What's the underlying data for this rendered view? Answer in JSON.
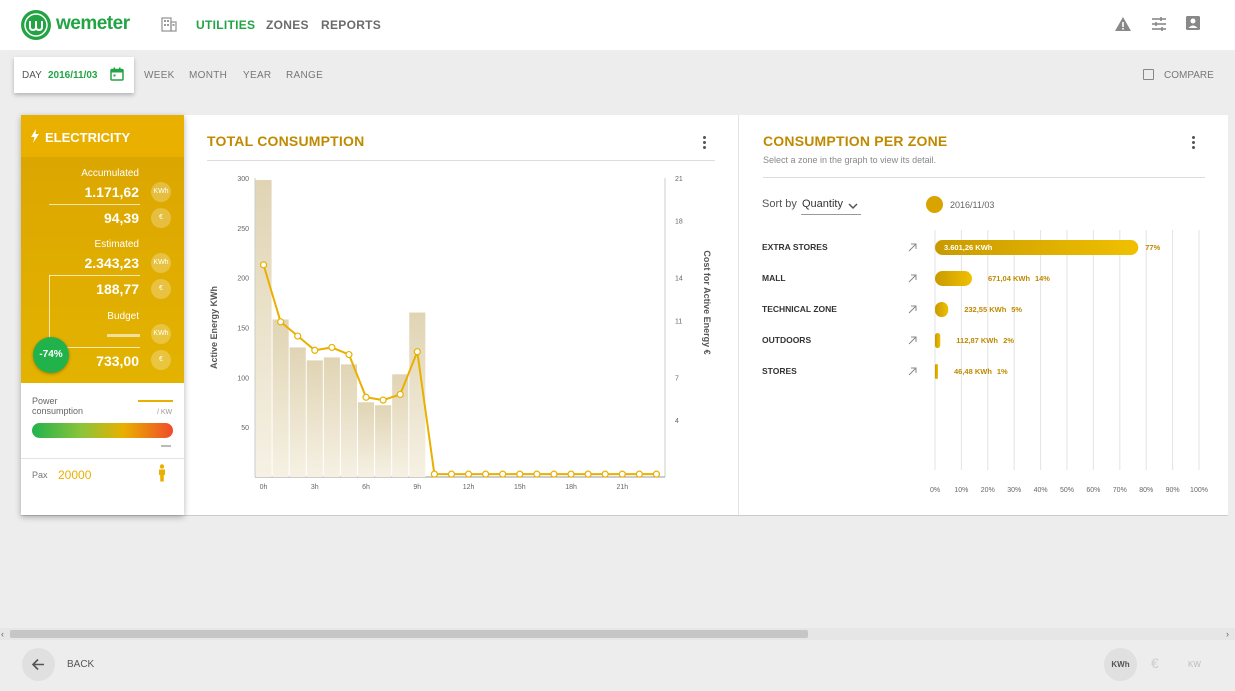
{
  "app": {
    "brand": "wemeter",
    "brand_color": "#22a445",
    "accent": "#e9b000"
  },
  "nav": {
    "items": [
      "UTILITIES",
      "ZONES",
      "REPORTS"
    ],
    "active": "UTILITIES"
  },
  "top_icons": [
    "warning-icon",
    "sliders-icon",
    "account-icon"
  ],
  "date": {
    "label": "DAY",
    "value": "2016/11/03",
    "periods": [
      "WEEK",
      "MONTH",
      "YEAR",
      "RANGE"
    ],
    "compare": "COMPARE"
  },
  "electricity": {
    "title": "ELECTRICITY",
    "accumulated_label": "Accumulated",
    "accumulated_kwh": "1.171,62",
    "accumulated_eur": "94,39",
    "estimated_label": "Estimated",
    "estimated_kwh": "2.343,23",
    "estimated_eur": "188,77",
    "budget_label": "Budget",
    "budget_eur": "733,00",
    "badge": "-74%",
    "unit_kwh": "KWh",
    "unit_eur": "€",
    "power_label_1": "Power",
    "power_label_2": "consumption",
    "power_unit": "/ KW",
    "pax_label": "Pax",
    "pax_value": "20000"
  },
  "total_consumption": {
    "title": "TOTAL CONSUMPTION"
  },
  "zone_panel": {
    "title": "CONSUMPTION PER ZONE",
    "subtitle": "Select a zone in the graph to view its detail.",
    "sort_label": "Sort by",
    "sort_value": "Quantity",
    "legend": "2016/11/03"
  },
  "chart_data": [
    {
      "type": "bar",
      "ylabel": "Active Energy KWh",
      "y2label": "Cost for Active Energy €",
      "yticks": [
        50,
        100,
        150,
        200,
        250,
        300
      ],
      "y2ticks": [
        4,
        7,
        11,
        14,
        18,
        21
      ],
      "ylim": [
        0,
        300
      ],
      "y2lim": [
        0,
        21
      ],
      "xticks": [
        "0h",
        "3h",
        "6h",
        "9h",
        "12h",
        "15h",
        "18h",
        "21h"
      ],
      "x": [
        0,
        1,
        2,
        3,
        4,
        5,
        6,
        7,
        8,
        9,
        10,
        11,
        12,
        13,
        14,
        15,
        16,
        17,
        18,
        19,
        20,
        21,
        22,
        23
      ],
      "series": [
        {
          "values": [
            298,
            158,
            130,
            117,
            120,
            113,
            75,
            72,
            103,
            165,
            0,
            0,
            0,
            0,
            0,
            0,
            0,
            0,
            0,
            0,
            0,
            0,
            0,
            0
          ]
        },
        {
          "values": [
            14.9,
            10.9,
            9.9,
            8.9,
            9.1,
            8.6,
            5.6,
            5.4,
            5.8,
            8.8,
            0.2,
            0.2,
            0.2,
            0.2,
            0.2,
            0.2,
            0.2,
            0.2,
            0.2,
            0.2,
            0.2,
            0.2,
            0.2,
            0.2
          ]
        }
      ]
    },
    {
      "type": "bar",
      "categories": [
        "EXTRA STORES",
        "MALL",
        "TECHNICAL ZONE",
        "OUTDOORS",
        "STORES"
      ],
      "value_labels": [
        "3.601,26 KWh",
        "671,04 KWh",
        "232,55 KWh",
        "112,87 KWh",
        "46,48 KWh"
      ],
      "values": [
        3601.26,
        671.04,
        232.55,
        112.87,
        46.48
      ],
      "percent_labels": [
        "77%",
        "14%",
        "5%",
        "2%",
        "1%"
      ],
      "percent": [
        77,
        14,
        5,
        2,
        1
      ],
      "xticks": [
        "0%",
        "10%",
        "20%",
        "30%",
        "40%",
        "50%",
        "60%",
        "70%",
        "80%",
        "90%",
        "100%"
      ],
      "xlim": [
        0,
        100
      ]
    }
  ],
  "footer": {
    "back": "BACK",
    "unit_kwh": "KWh",
    "unit_eur": "€",
    "unit_kw": "KW"
  }
}
